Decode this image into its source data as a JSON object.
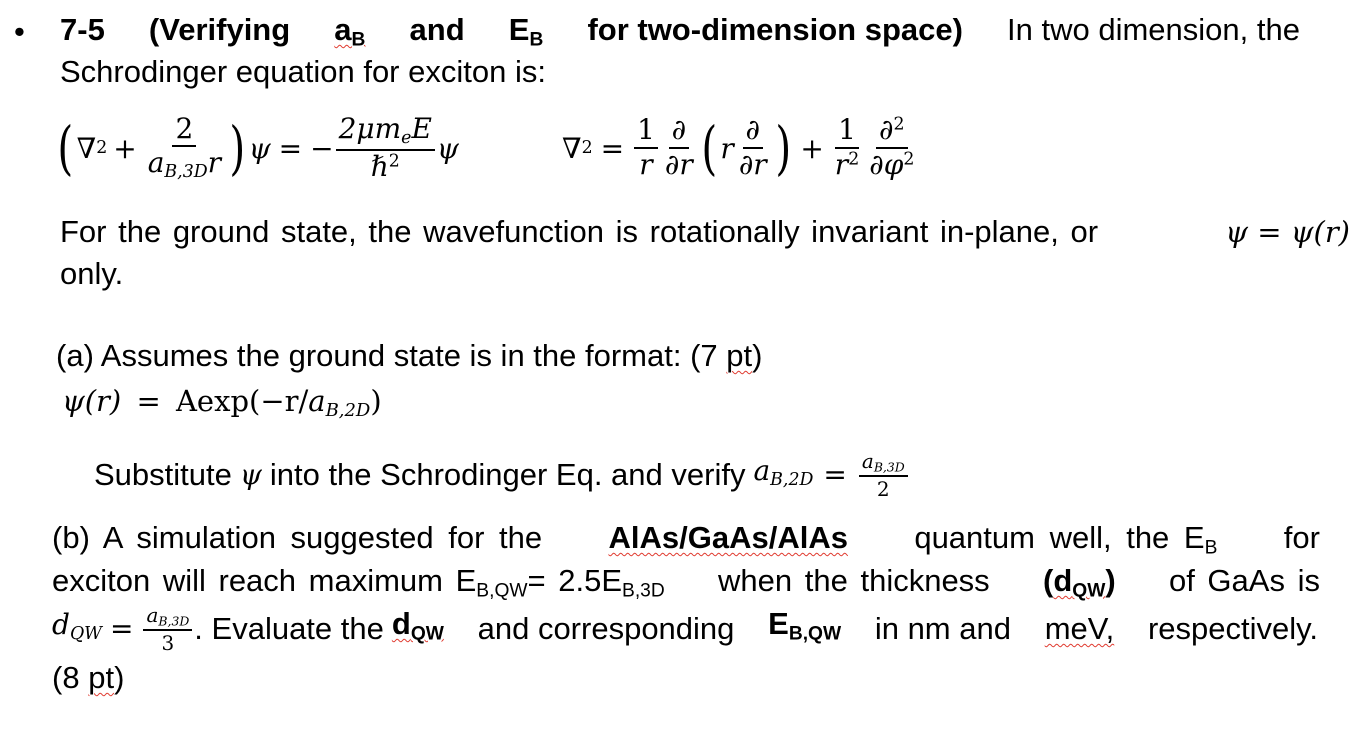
{
  "bullet": "•",
  "problem": {
    "title_number": "7-5",
    "title_open": "(Verifying",
    "title_a": "a",
    "title_a_sub": "B",
    "title_and": "and",
    "title_E": "E",
    "title_E_sub": "B",
    "title_rest": "for two-dimension space)",
    "intro_rest": "In two dimension, the",
    "intro_line2": "Schrodinger equation for exciton is:"
  },
  "equation1": {
    "nabla": "∇",
    "sq": "2",
    "plus": "+",
    "num": "2",
    "den_a": "a",
    "den_sub": "B,3D",
    "den_r": "r",
    "psi": "ψ",
    "eq": "=",
    "minus": "−",
    "rhs_num": "2μm",
    "rhs_num_sub": "e",
    "rhs_num_E": "E",
    "rhs_den": "ℏ",
    "rhs_den_sup": "2",
    "psi2": "ψ"
  },
  "equation2": {
    "nabla": "∇",
    "sq": "2",
    "eq": "=",
    "f1_num": "1",
    "f1_den": "r",
    "f2_num": "∂",
    "f2_den": "∂r",
    "r": "r",
    "f3_num": "∂",
    "f3_den": "∂r",
    "plus": "+",
    "f4_num": "1",
    "f4_den": "r",
    "f4_den_sup": "2",
    "f5_num": "∂",
    "f5_num_sup": "2",
    "f5_den": "∂φ",
    "f5_den_sup": "2"
  },
  "ground_state": {
    "line1": "For the ground state, the wavefunction is rotationally invariant in-plane, or",
    "math": "ψ = ψ(r)",
    "line2": "only."
  },
  "part_a": {
    "prompt": "(a) Assumes the ground state is in the format: (7",
    "pt": "pt",
    "close": ")",
    "eq_lhs": "ψ(r)",
    "eq_eq": "=",
    "eq_rhs": "Aexp(−r/",
    "eq_a": "a",
    "eq_sub": "B,2D",
    "eq_close": ")",
    "verify_text1": "Substitute",
    "verify_psi": "ψ",
    "verify_text2": "into the Schrodinger Eq. and verify",
    "verify_a": "a",
    "verify_sub": "B,2D",
    "verify_eq": "=",
    "verify_num_a": "a",
    "verify_num_sub": "B,3D",
    "verify_den": "2"
  },
  "part_b": {
    "l1_a": "(b) A simulation suggested for the",
    "l1_material": "AlAs/GaAs/AlAs",
    "l1_b": "quantum well, the E",
    "l1_sub": "B",
    "l1_c": "for",
    "l2_a": "exciton will reach maximum E",
    "l2_sub1": "B,QW",
    "l2_b": "= 2.5E",
    "l2_sub2": "B,3D",
    "l2_c": "when the thickness",
    "l2_d_open": "(",
    "l2_d": "d",
    "l2_d_sub": "QW",
    "l2_d_close": ")",
    "l2_e": "of GaAs is",
    "l3_d": "d",
    "l3_dsub": "QW",
    "l3_eq": "=",
    "l3_num_a": "a",
    "l3_num_sub": "B,3D",
    "l3_den": "3",
    "l3_a": ". Evaluate the",
    "l3_bold_d": "d",
    "l3_bold_dsub": "QW",
    "l3_b": "and corresponding",
    "l3_bold_E": "E",
    "l3_bold_Esub": "B,QW",
    "l3_c": "in nm and",
    "l3_mev": "meV,",
    "l3_d2": "respectively.",
    "l4_open": "(8",
    "l4_pt": "pt",
    "l4_close": ")"
  }
}
